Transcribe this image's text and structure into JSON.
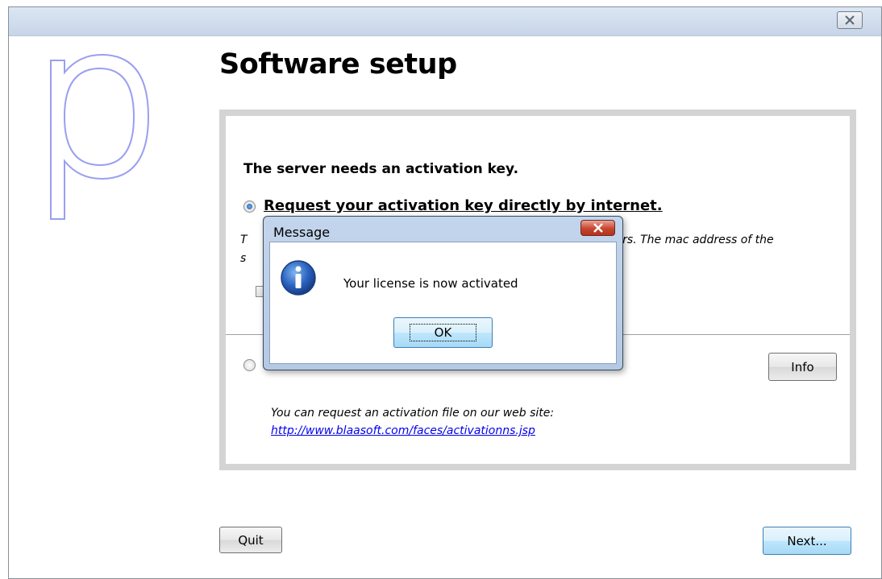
{
  "window": {
    "title": "Software setup",
    "logo_letter": "p"
  },
  "panel": {
    "heading": "The server needs an activation key.",
    "option_internet": {
      "label": "Request your activation key directly by internet.",
      "selected": true
    },
    "description_visible_start": "T",
    "description_visible_end": "ers. The mac address of the",
    "description_line2_start": "s",
    "option_file": {
      "selected": false
    },
    "info_button": "Info",
    "web_note": "You can request an activation file on our web site:",
    "web_link": "http://www.blaasoft.com/faces/activationns.jsp"
  },
  "footer": {
    "quit_button": "Quit",
    "next_button": "Next..."
  },
  "dialog": {
    "title": "Message",
    "message": "Your license is now activated",
    "ok_button": "OK",
    "icon": "info-icon"
  },
  "colors": {
    "logo_stroke": "#9a9ff0",
    "link": "#0000ee",
    "dialog_frame": "#b4c9e4",
    "close_red": "#c7452f"
  }
}
